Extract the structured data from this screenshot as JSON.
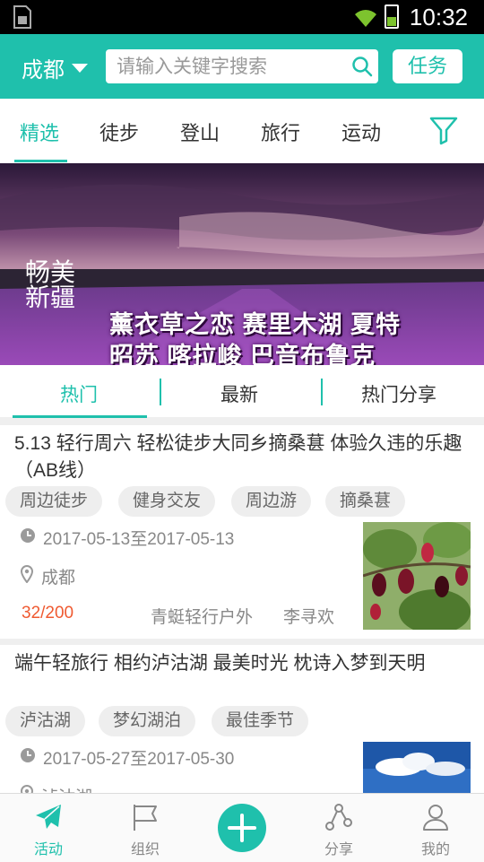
{
  "status_bar": {
    "time": "10:32"
  },
  "header": {
    "city": "成都",
    "search_placeholder": "请输入关键字搜索",
    "task_label": "任务"
  },
  "category_tabs": [
    "精选",
    "徒步",
    "登山",
    "旅行",
    "运动"
  ],
  "banner": {
    "line1": "薰衣草之恋 赛里木湖 夏特",
    "line2": "昭苏 喀拉峻 巴音布鲁克",
    "logo_text": "畅美新疆"
  },
  "sub_tabs": [
    "热门",
    "最新",
    "热门分享"
  ],
  "activities": [
    {
      "title": "5.13 轻行周六 轻松徒步大同乡摘桑葚 体验久违的乐趣（AB线）",
      "tags": [
        "周边徒步",
        "健身交友",
        "周边游",
        "摘桑葚"
      ],
      "date": "2017-05-13至2017-05-13",
      "location": "成都",
      "count": "32/200",
      "organizer": "青蜓轻行户外",
      "leader": "李寻欢"
    },
    {
      "title": "端午轻旅行 相约泸沽湖 最美时光 枕诗入梦到天明",
      "tags": [
        "泸沽湖",
        "梦幻湖泊",
        "最佳季节"
      ],
      "date": "2017-05-27至2017-05-30",
      "location": "泸沽湖"
    }
  ],
  "bottom_nav": [
    "活动",
    "组织",
    "分享",
    "我的"
  ],
  "colors": {
    "accent": "#1fc0ac",
    "count": "#ef5a31"
  }
}
